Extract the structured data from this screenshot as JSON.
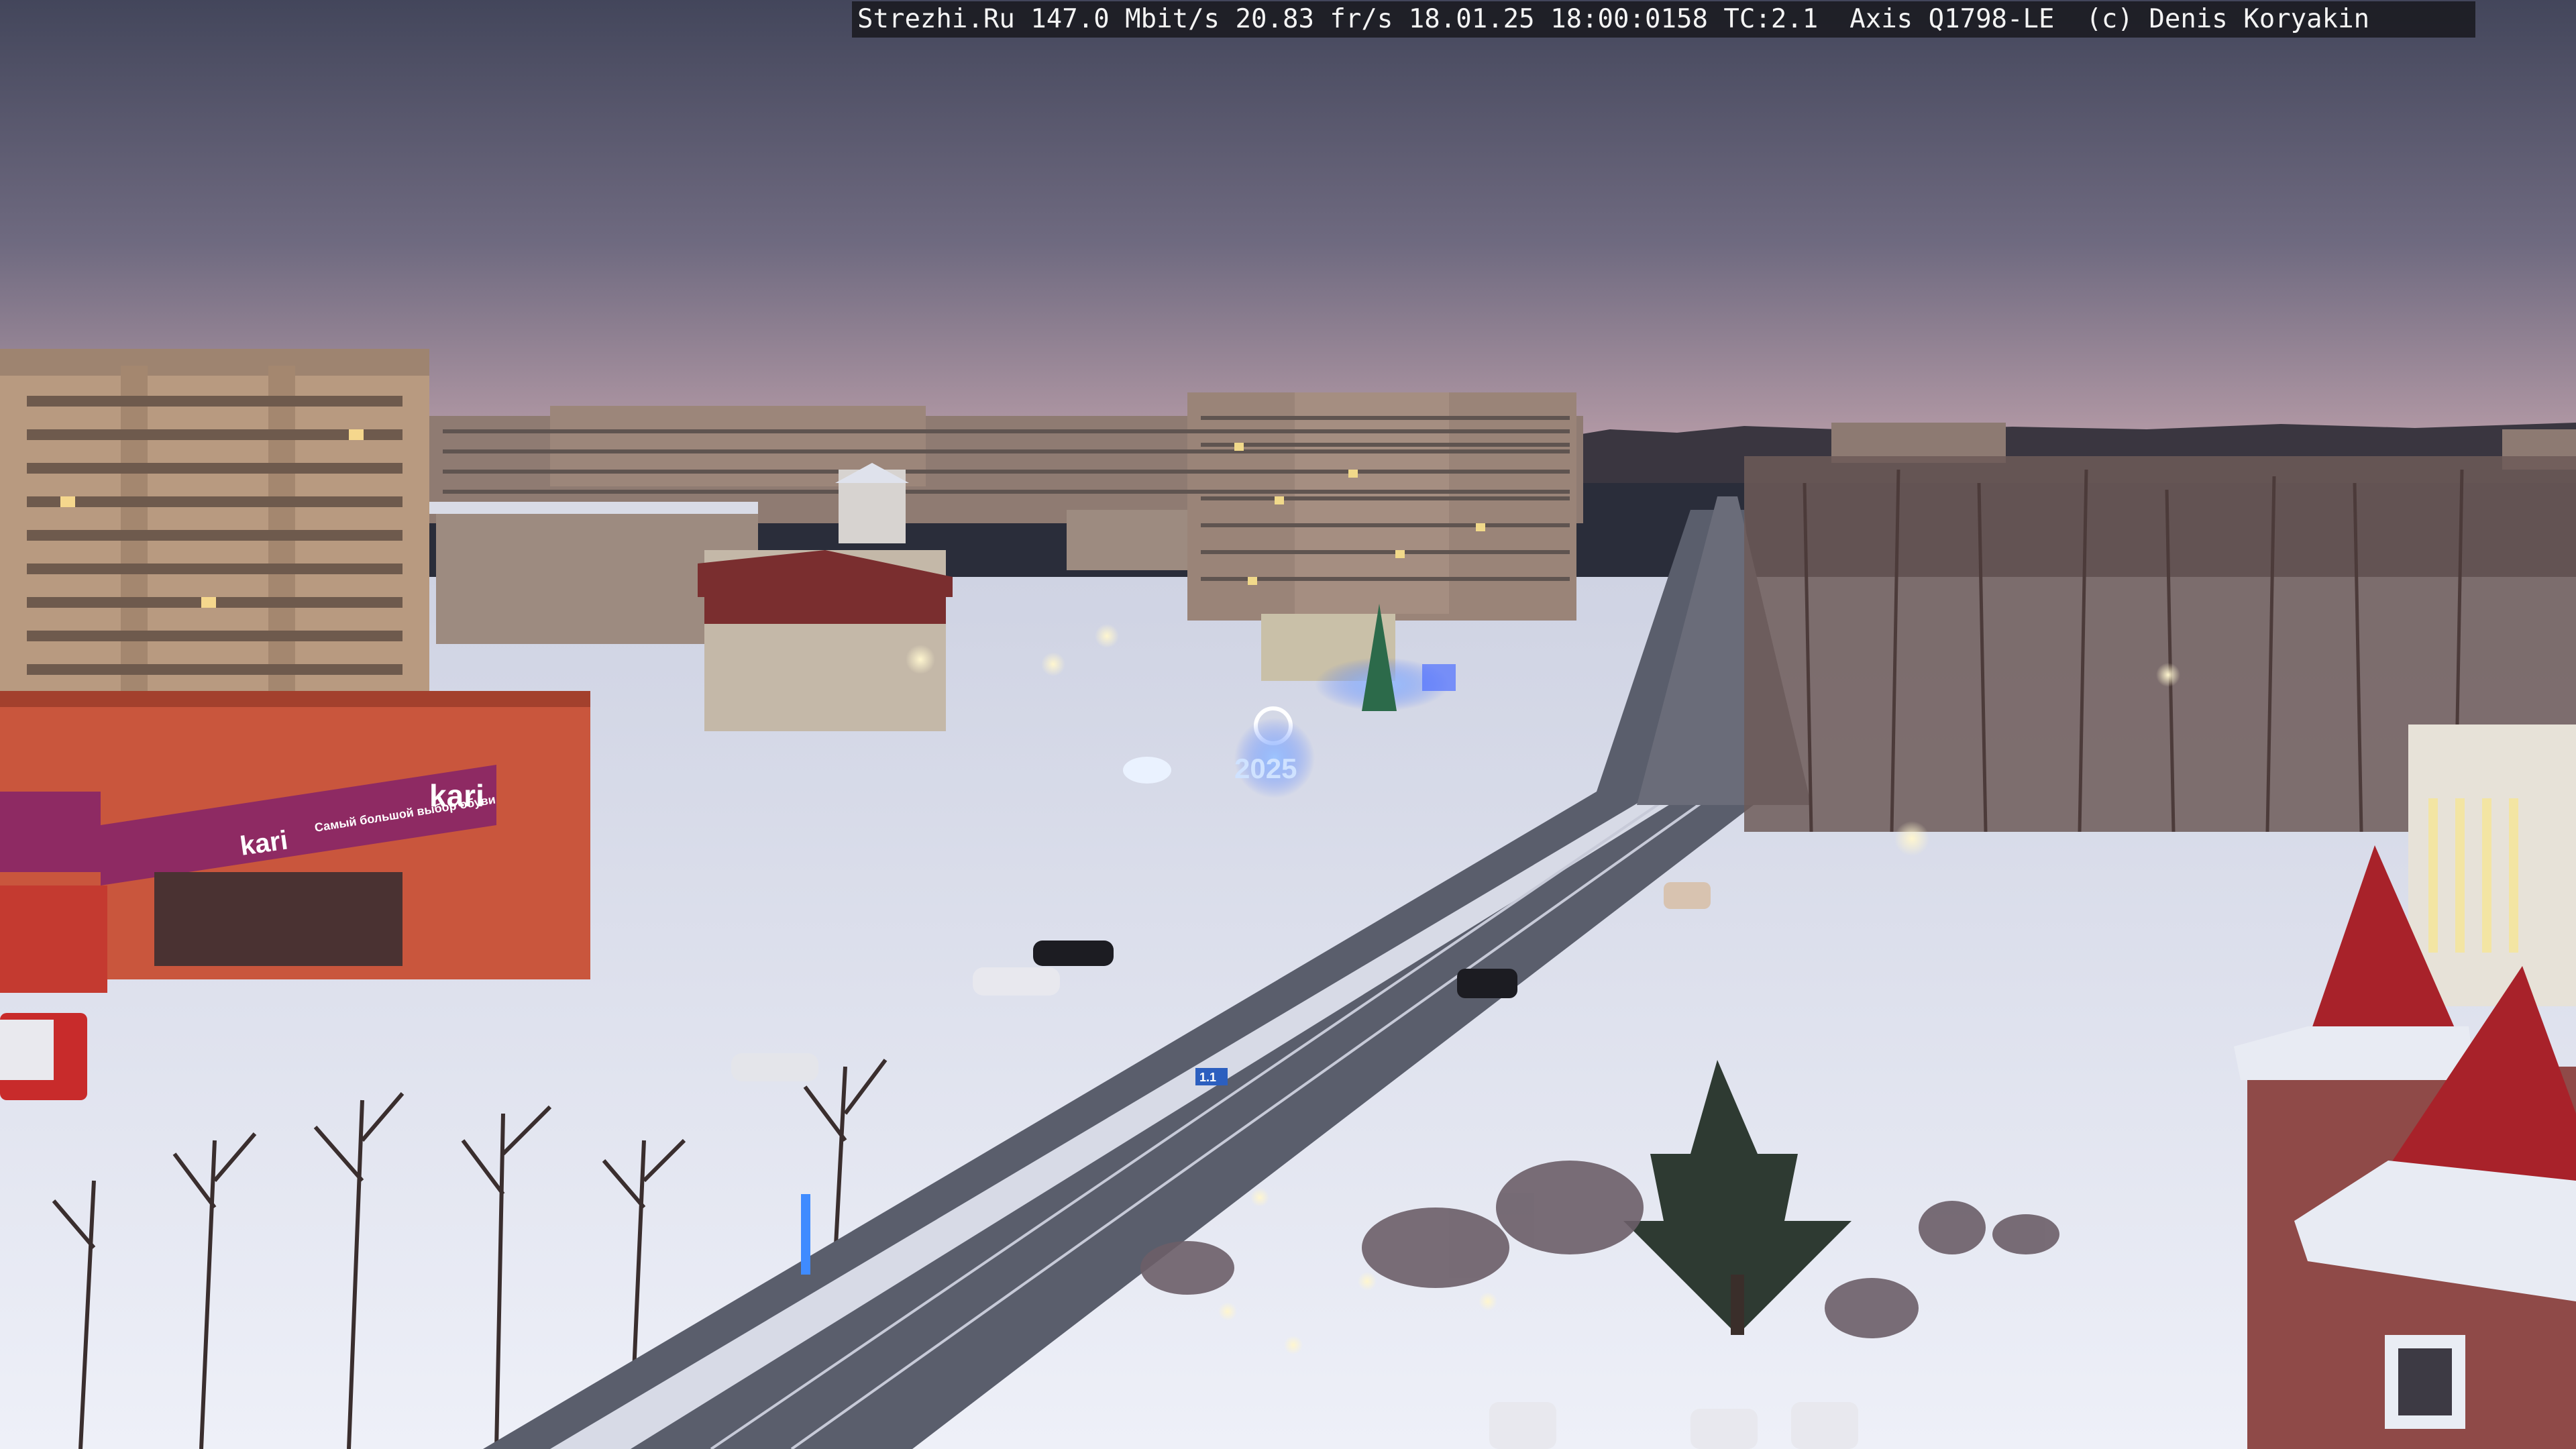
{
  "overlay": {
    "text": "Strezhi.Ru 147.0 Mbit/s 20.83 fr/s 18.01.25 18:00:0158 TC:2.1  Axis Q1798-LE  (c) Denis Koryakin"
  },
  "scene": {
    "store_sign_main": "kari",
    "store_sign_left": "kari",
    "store_sign_strip": "Самый большой выбор обуви",
    "year_display": "2025",
    "road_sign": "1.1"
  },
  "colors": {
    "sky_top": "#4b4d63",
    "sky_horizon": "#b59ba6",
    "snow": "#e9ecf7",
    "road": "#5a5e6c",
    "kari_facade": "#c9563d",
    "kari_sign": "#8e2a63",
    "holiday_light": "#3f8bff"
  }
}
